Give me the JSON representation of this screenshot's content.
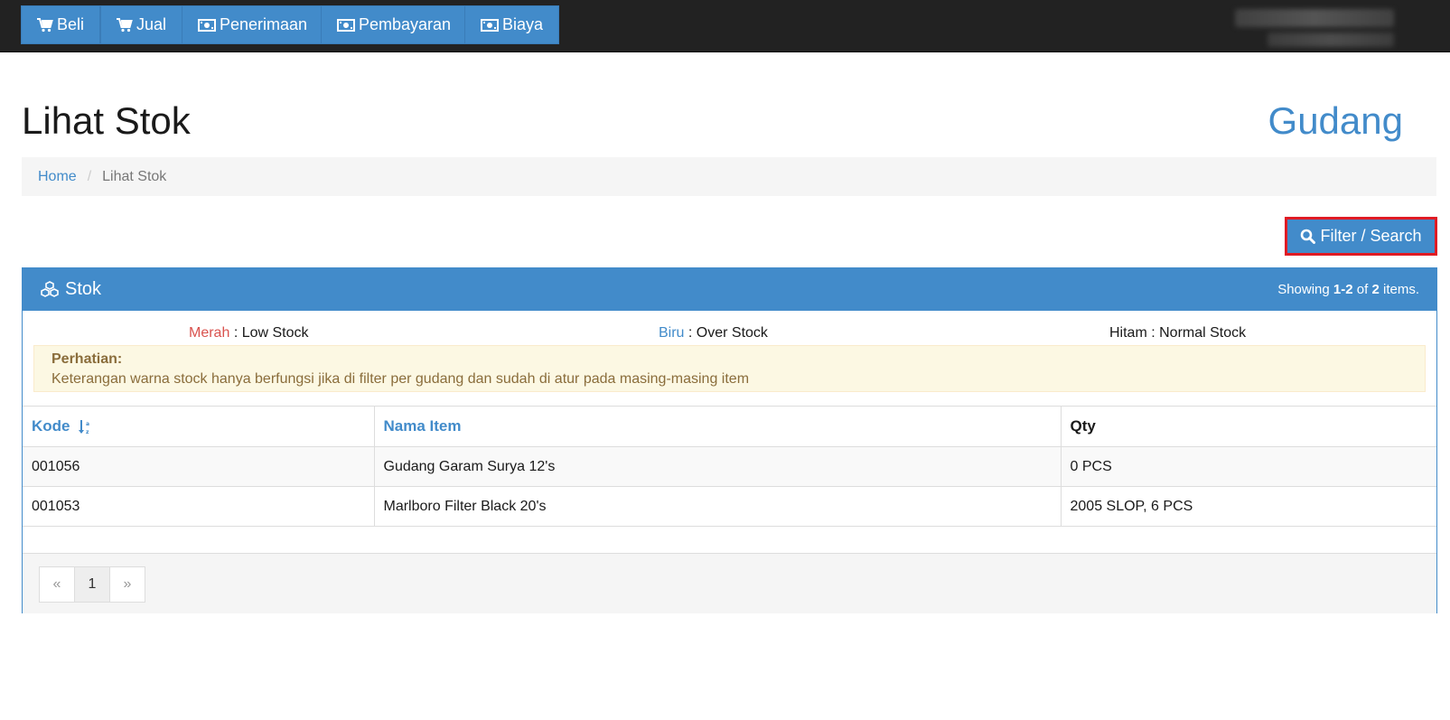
{
  "nav": {
    "items": [
      {
        "label": "Beli",
        "icon": "shopping-cart-icon"
      },
      {
        "label": "Jual",
        "icon": "shopping-cart-icon"
      },
      {
        "label": "Penerimaan",
        "icon": "money-icon"
      },
      {
        "label": "Pembayaran",
        "icon": "money-icon"
      },
      {
        "label": "Biaya",
        "icon": "money-icon"
      }
    ]
  },
  "page": {
    "title": "Lihat Stok",
    "section": "Gudang"
  },
  "breadcrumb": {
    "home": "Home",
    "separator": "/",
    "current": "Lihat Stok"
  },
  "filter_button": {
    "label": "Filter / Search",
    "icon": "search-icon"
  },
  "panel": {
    "title": "Stok",
    "icon": "cubes-icon",
    "summary_prefix": "Showing",
    "summary_range": "1-2",
    "summary_of": "of",
    "summary_total": "2",
    "summary_suffix": "items."
  },
  "legend": {
    "red_label": "Merah",
    "red_text": ": Low Stock",
    "blue_label": "Biru",
    "blue_text": ": Over Stock",
    "black_label": "Hitam",
    "black_text": ": Normal Stock"
  },
  "alert": {
    "title": "Perhatian:",
    "message": "Keterangan warna stock hanya berfungsi jika di filter per gudang dan sudah di atur pada masing-masing item"
  },
  "table": {
    "headers": [
      "Kode",
      "Nama Item",
      "Qty"
    ],
    "rows": [
      [
        "001056",
        "Gudang Garam Surya 12's",
        "0 PCS"
      ],
      [
        "001053",
        "Marlboro Filter Black 20's",
        "2005 SLOP, 6 PCS"
      ]
    ]
  },
  "pagination": {
    "prev": "«",
    "page": "1",
    "next": "»"
  },
  "colors": {
    "primary": "#428bca",
    "navbar": "#222222",
    "danger": "#d9534f",
    "highlight_border": "#e01b24"
  }
}
